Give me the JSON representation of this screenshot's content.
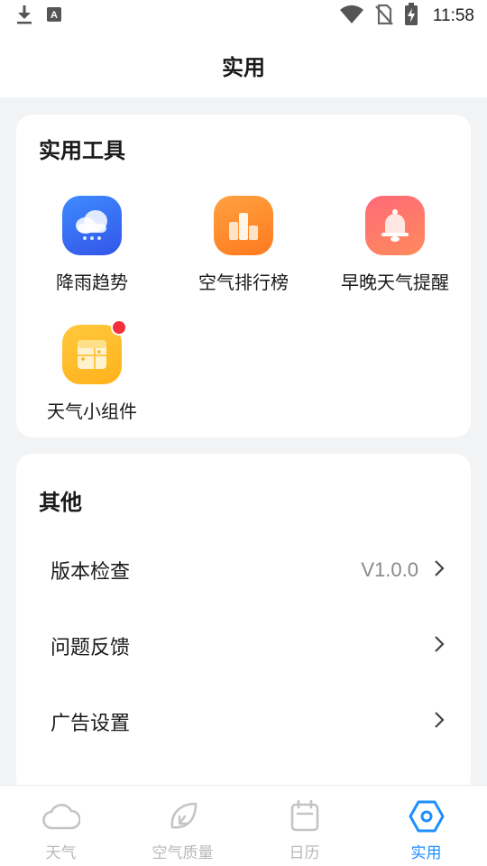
{
  "status_bar": {
    "time": "11:58",
    "icons": [
      "download-icon",
      "a-keyboard-icon",
      "wifi-icon",
      "no-sim-icon",
      "battery-charging-icon"
    ]
  },
  "header": {
    "title": "实用"
  },
  "tools_card": {
    "title": "实用工具",
    "items": [
      {
        "label": "降雨趋势",
        "icon": "rain-cloud-icon",
        "color": "#3d6df0"
      },
      {
        "label": "空气排行榜",
        "icon": "ranking-bars-icon",
        "color": "#ff8a2a"
      },
      {
        "label": "早晚天气提醒",
        "icon": "bell-icon",
        "color": "#ff6a70"
      },
      {
        "label": "天气小组件",
        "icon": "widget-icon",
        "color": "#ffbd2b",
        "badge": true
      }
    ]
  },
  "other_card": {
    "title": "其他",
    "rows": [
      {
        "label": "版本检查",
        "value": "V1.0.0"
      },
      {
        "label": "问题反馈",
        "value": ""
      },
      {
        "label": "广告设置",
        "value": ""
      }
    ]
  },
  "bottom_nav": {
    "items": [
      {
        "label": "天气",
        "icon": "cloud-icon",
        "active": false
      },
      {
        "label": "空气质量",
        "icon": "leaf-icon",
        "active": false
      },
      {
        "label": "日历",
        "icon": "calendar-icon",
        "active": false
      },
      {
        "label": "实用",
        "icon": "hexagon-gear-icon",
        "active": true
      }
    ],
    "active_color": "#1f8fff",
    "inactive_color": "#b8b8b8"
  }
}
